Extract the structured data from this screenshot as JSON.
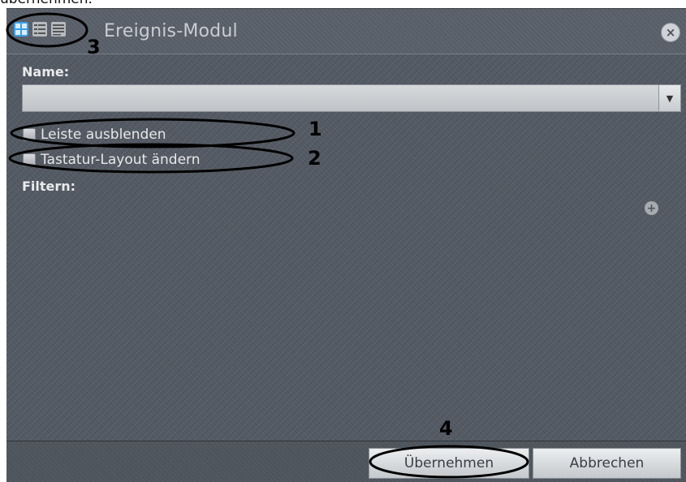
{
  "top_text": "übernehmen.",
  "dialog": {
    "title": "Ereignis-Modul",
    "view_buttons": [
      "grid-view-icon",
      "list-view-icon",
      "detail-view-icon"
    ],
    "close_icon": "close-icon",
    "name_label": "Name:",
    "name_value": "",
    "checkbox_hide_bar": "Leiste ausblenden",
    "checkbox_keyboard_layout": "Tastatur-Layout ändern",
    "filter_label": "Filtern:",
    "add_filter_icon": "plus-icon",
    "apply_button": "Übernehmen",
    "cancel_button": "Abbrechen"
  },
  "annotations": {
    "label_1": "1",
    "label_2": "2",
    "label_3": "3",
    "label_4": "4"
  },
  "colors": {
    "dialog_bg": "#535962",
    "highlight_blue": "#3aa0e8",
    "annotation_black": "#000000"
  }
}
